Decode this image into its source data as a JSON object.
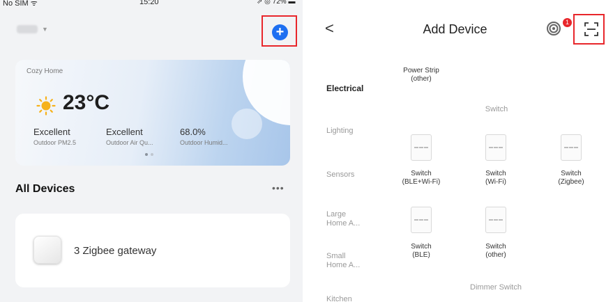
{
  "status_bar": {
    "carrier": "No SIM ᯤ",
    "time": "15:20",
    "right": "⇗ ◎ 72% ▬"
  },
  "left": {
    "add_label": "+",
    "weather": {
      "home_name": "Cozy Home",
      "temperature": "23°C",
      "metrics": [
        {
          "value": "Excellent",
          "label": "Outdoor PM2.5"
        },
        {
          "value": "Excellent",
          "label": "Outdoor Air Qu..."
        },
        {
          "value": "68.0%",
          "label": "Outdoor Humid..."
        }
      ]
    },
    "all_devices_label": "All Devices",
    "more_label": "•••",
    "device": {
      "name": "3 Zigbee gateway"
    }
  },
  "right": {
    "back_label": "<",
    "title": "Add Device",
    "badge_count": "1",
    "categories": [
      {
        "label": "Electrical"
      },
      {
        "label": "Lighting"
      },
      {
        "label": "Sensors"
      },
      {
        "label": "Large\nHome A..."
      },
      {
        "label": "Small\nHome A..."
      },
      {
        "label": "Kitchen"
      }
    ],
    "power_strip_label": "Power Strip\n(other)",
    "switch_section": "Switch",
    "dimmer_section": "Dimmer Switch",
    "devices": [
      {
        "label": "Switch\n(BLE+Wi-Fi)"
      },
      {
        "label": "Switch\n(Wi-Fi)"
      },
      {
        "label": "Switch\n(Zigbee)"
      },
      {
        "label": "Switch\n(BLE)"
      },
      {
        "label": "Switch\n(other)"
      }
    ]
  },
  "colors": {
    "accent": "#1e6ff1",
    "highlight": "#e8262b"
  },
  "icons": [
    "plus-circle-icon",
    "sun-icon",
    "gateway-icon",
    "back-icon",
    "scan-ring-icon",
    "scan-icon",
    "switch-icon"
  ]
}
